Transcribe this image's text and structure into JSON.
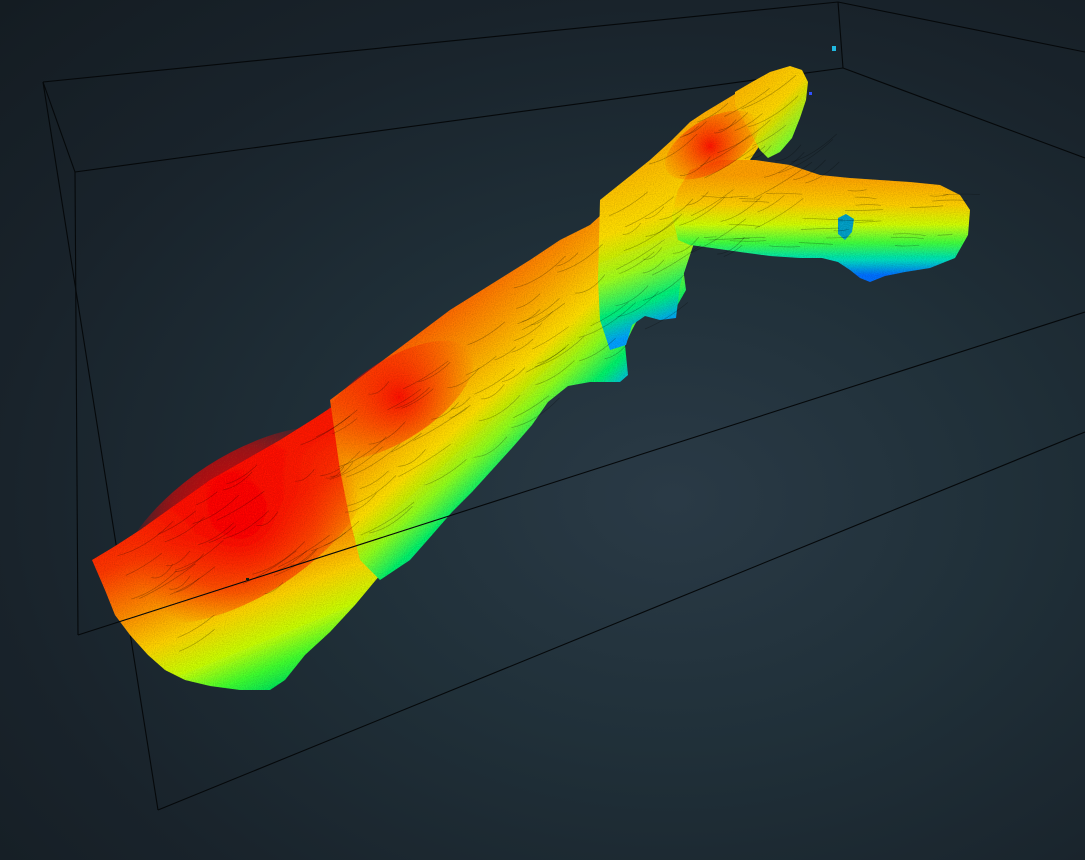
{
  "viewer": {
    "background_color": "#1c2830",
    "bbox_line_color": "#05080a",
    "colormap": "jet",
    "colormap_stops": [
      "#0000ff",
      "#00c8ff",
      "#00ff40",
      "#c8ff00",
      "#ffd000",
      "#ff6000",
      "#ff0000"
    ],
    "show_bounding_box": true
  }
}
